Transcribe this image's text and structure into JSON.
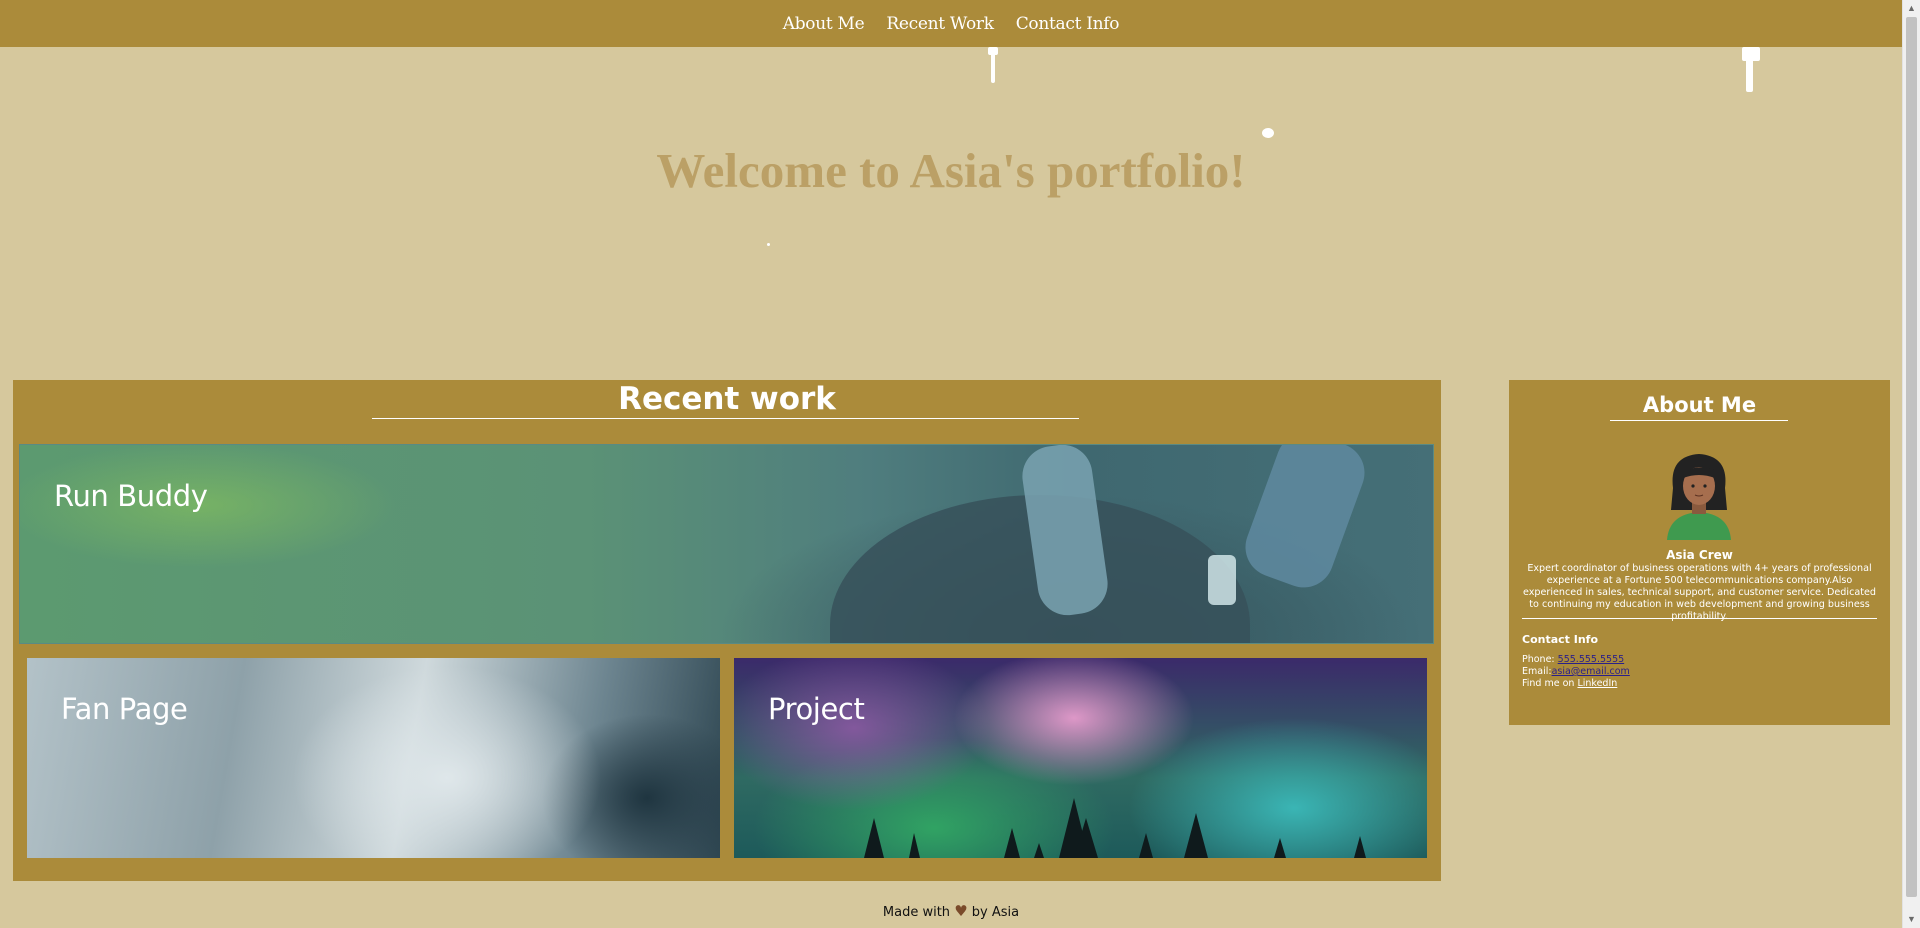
{
  "nav": {
    "items": [
      "About Me",
      "Recent Work",
      "Contact Info"
    ]
  },
  "hero": {
    "title": "Welcome to Asia's portfolio!"
  },
  "recent_work": {
    "title": "Recent work",
    "projects": [
      {
        "label": "Run Buddy"
      },
      {
        "label": "Fan Page"
      },
      {
        "label": "Project"
      }
    ]
  },
  "about": {
    "title": "About Me",
    "name": "Asia Crew",
    "bio": "Expert coordinator of business operations with 4+ years of professional experience at a Fortune 500 telecommunications company.Also experienced in sales, technical support, and customer service. Dedicated to continuing my education in web development and growing business profitability.",
    "contact": {
      "title": "Contact Info",
      "phone_label": "Phone:",
      "phone": "555.555.5555",
      "email_label": "Email:",
      "email": "asia@email.com",
      "linkedin_label": "Find me on",
      "linkedin": "LinkedIn"
    }
  },
  "footer": {
    "before": "Made with",
    "heart": "♥",
    "after": "by Asia"
  },
  "colors": {
    "background": "#d6c89d",
    "accent": "#ab8b3a",
    "hero_text": "#bba066"
  }
}
